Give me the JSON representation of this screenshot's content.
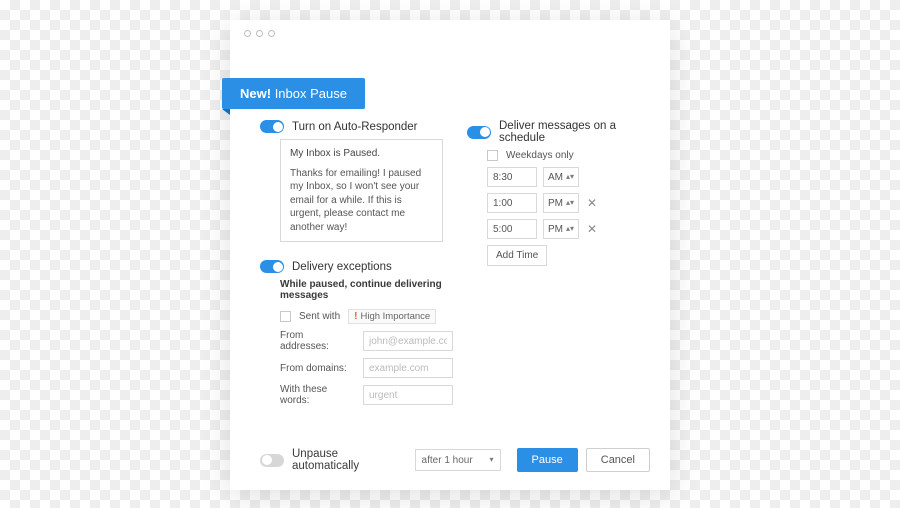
{
  "badge": {
    "new": "New!",
    "title": "Inbox Pause"
  },
  "autoresponder": {
    "title": "Turn on Auto-Responder",
    "on": true,
    "subject": "My Inbox is Paused.",
    "body": "Thanks for emailing! I paused my Inbox, so I won't see your email for a while. If this is urgent, please contact me another way!"
  },
  "exceptions": {
    "title": "Delivery exceptions",
    "on": true,
    "heading": "While paused, continue delivering messages",
    "sentwith_label": "Sent with",
    "high_importance": "High Importance",
    "sentwith_checked": false,
    "from_addresses_label": "From addresses:",
    "from_addresses_placeholder": "john@example.com",
    "from_domains_label": "From domains:",
    "from_domains_placeholder": "example.com",
    "with_words_label": "With these words:",
    "with_words_placeholder": "urgent"
  },
  "schedule": {
    "title": "Deliver messages on a schedule",
    "on": true,
    "weekdays_label": "Weekdays only",
    "weekdays_checked": false,
    "times": [
      {
        "time": "8:30",
        "ampm": "AM",
        "removable": false
      },
      {
        "time": "1:00",
        "ampm": "PM",
        "removable": true
      },
      {
        "time": "5:00",
        "ampm": "PM",
        "removable": true
      }
    ],
    "add_time": "Add Time"
  },
  "footer": {
    "unpause_label": "Unpause automatically",
    "unpause_on": false,
    "unpause_after": "after 1 hour",
    "pause": "Pause",
    "cancel": "Cancel"
  }
}
